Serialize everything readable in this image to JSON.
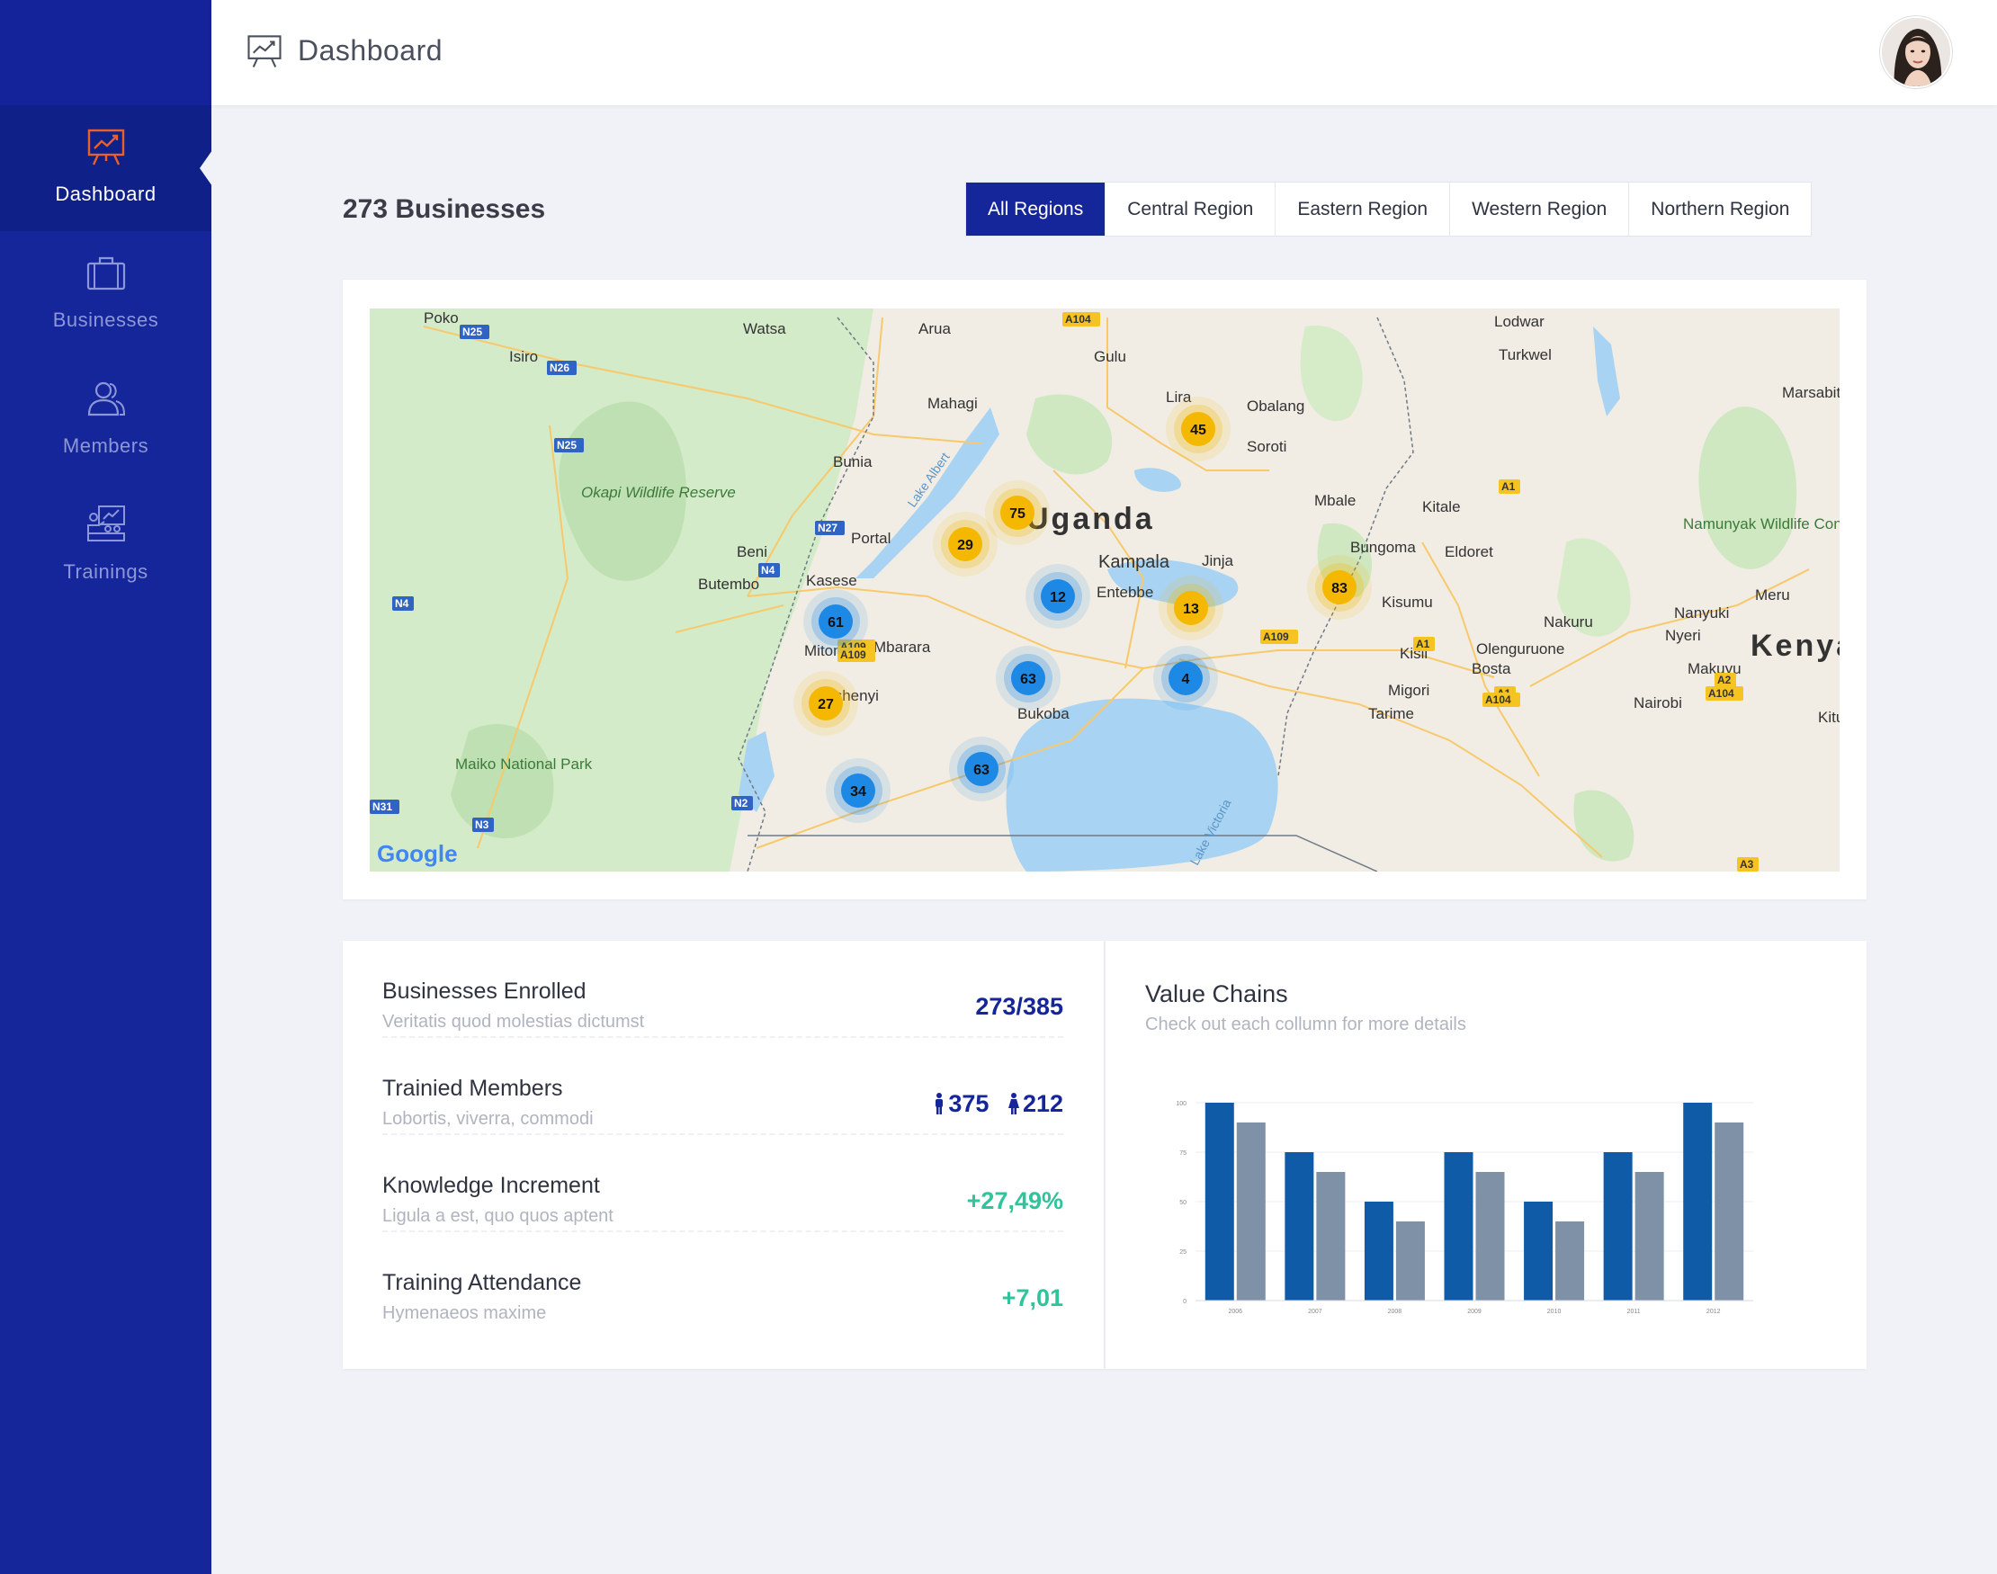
{
  "sidebar": {
    "items": [
      {
        "label": "Dashboard",
        "icon": "presentation-chart-icon",
        "active": true
      },
      {
        "label": "Businesses",
        "icon": "briefcase-icon",
        "active": false
      },
      {
        "label": "Members",
        "icon": "users-icon",
        "active": false
      },
      {
        "label": "Trainings",
        "icon": "training-board-icon",
        "active": false
      }
    ]
  },
  "header": {
    "title": "Dashboard",
    "icon": "presentation-chart-icon",
    "avatar": "user-avatar"
  },
  "businesses": {
    "count_label": "273 Businesses"
  },
  "region_tabs": [
    {
      "label": "All Regions",
      "active": true
    },
    {
      "label": "Central Region",
      "active": false
    },
    {
      "label": "Eastern Region",
      "active": false
    },
    {
      "label": "Western Region",
      "active": false
    },
    {
      "label": "Northern Region",
      "active": false
    }
  ],
  "map": {
    "country_label": "Uganda",
    "kenya_label": "Kenya",
    "provider": "Google",
    "lake_albert_label": "Lake Albert",
    "lake_victoria_label": "Lake Victoria",
    "parks": [
      {
        "id": "okapi",
        "name": "Okapi Wildlife Reserve"
      },
      {
        "id": "maiko",
        "name": "Maiko National Park"
      },
      {
        "id": "namunyak",
        "name": "Namunyak Wildlife Conservation Trust"
      }
    ],
    "cities": [
      {
        "id": "watsa",
        "name": "Watsa"
      },
      {
        "id": "arua",
        "name": "Arua"
      },
      {
        "id": "gulu",
        "name": "Gulu"
      },
      {
        "id": "lodwar",
        "name": "Lodwar"
      },
      {
        "id": "isiro",
        "name": "Isiro"
      },
      {
        "id": "turkwel",
        "name": "Turkwel"
      },
      {
        "id": "mahagi",
        "name": "Mahagi"
      },
      {
        "id": "lira",
        "name": "Lira"
      },
      {
        "id": "obalang",
        "name": "Obalang"
      },
      {
        "id": "marsabit",
        "name": "Marsabit"
      },
      {
        "id": "soroti",
        "name": "Soroti"
      },
      {
        "id": "bunia",
        "name": "Bunia"
      },
      {
        "id": "mbale",
        "name": "Mbale"
      },
      {
        "id": "kitale",
        "name": "Kitale"
      },
      {
        "id": "fortportal",
        "name": "Portal"
      },
      {
        "id": "beni",
        "name": "Beni"
      },
      {
        "id": "jinja",
        "name": "Jinja"
      },
      {
        "id": "bungoma",
        "name": "Bungoma"
      },
      {
        "id": "eldoret",
        "name": "Eldoret"
      },
      {
        "id": "kampala",
        "name": "Kampala"
      },
      {
        "id": "kasese",
        "name": "Kasese"
      },
      {
        "id": "butembo",
        "name": "Butembo"
      },
      {
        "id": "entebbe",
        "name": "Entebbe"
      },
      {
        "id": "kisumu",
        "name": "Kisumu"
      },
      {
        "id": "meru",
        "name": "Meru"
      },
      {
        "id": "nanyuki",
        "name": "Nanyuki"
      },
      {
        "id": "nakuru",
        "name": "Nakuru"
      },
      {
        "id": "nyeri",
        "name": "Nyeri"
      },
      {
        "id": "mitoma",
        "name": "Mitoma"
      },
      {
        "id": "mbarara",
        "name": "Mbarara"
      },
      {
        "id": "kisii",
        "name": "Kisii"
      },
      {
        "id": "olenguruone",
        "name": "Olenguruone"
      },
      {
        "id": "bosta",
        "name": "Bosta"
      },
      {
        "id": "makuyu",
        "name": "Makuyu"
      },
      {
        "id": "rushenyi",
        "name": "Rushenyi"
      },
      {
        "id": "migori",
        "name": "Migori"
      },
      {
        "id": "bukoba",
        "name": "Bukoba"
      },
      {
        "id": "tarime",
        "name": "Tarime"
      },
      {
        "id": "nairobi",
        "name": "Nairobi"
      },
      {
        "id": "kitui",
        "name": "Kitui"
      },
      {
        "id": "poko",
        "name": "Poko"
      }
    ],
    "roads": [
      "N25",
      "N26",
      "N25",
      "N27",
      "N4",
      "N4",
      "A109",
      "A109",
      "A109",
      "N2",
      "N3",
      "N31",
      "A104",
      "A1",
      "A1",
      "A1",
      "A104",
      "A2",
      "A104",
      "A3"
    ],
    "clusters": [
      {
        "id": "lira",
        "value": "45",
        "color": "#f5b800"
      },
      {
        "id": "masindi",
        "value": "75",
        "color": "#f5b800"
      },
      {
        "id": "hoima",
        "value": "29",
        "color": "#f5b800"
      },
      {
        "id": "nakasongola",
        "value": "12",
        "color": "#1e88e5"
      },
      {
        "id": "kamuli",
        "value": "13",
        "color": "#f5b800"
      },
      {
        "id": "mbale",
        "value": "83",
        "color": "#f5b800"
      },
      {
        "id": "fortportal",
        "value": "61",
        "color": "#1e88e5"
      },
      {
        "id": "mubende",
        "value": "63",
        "color": "#1e88e5"
      },
      {
        "id": "mukono",
        "value": "4",
        "color": "#1e88e5"
      },
      {
        "id": "kasese",
        "value": "27",
        "color": "#f5b800"
      },
      {
        "id": "masaka",
        "value": "63",
        "color": "#1e88e5"
      },
      {
        "id": "mitoma",
        "value": "34",
        "color": "#1e88e5"
      }
    ]
  },
  "stats": [
    {
      "title": "Businesses Enrolled",
      "subtitle": "Veritatis quod molestias dictumst",
      "value": "273/385",
      "style": "blue"
    },
    {
      "title": "Trainied Members",
      "subtitle": "Lobortis, viverra, commodi",
      "male": "375",
      "female": "212",
      "style": "blue"
    },
    {
      "title": "Knowledge Increment",
      "subtitle": "Ligula a est, quo quos aptent",
      "value": "+27,49%",
      "style": "green"
    },
    {
      "title": "Training Attendance",
      "subtitle": "Hymenaeos maxime",
      "value": "+7,01",
      "style": "green"
    }
  ],
  "value_chains": {
    "title": "Value Chains",
    "subtitle": "Check out each collumn for more details"
  },
  "chart_data": {
    "type": "bar",
    "categories": [
      "2006",
      "2007",
      "2008",
      "2009",
      "2010",
      "2011",
      "2012"
    ],
    "series": [
      {
        "values": [
          100,
          75,
          50,
          75,
          50,
          75,
          100
        ],
        "color": "#0f5ba8"
      },
      {
        "values": [
          90,
          65,
          40,
          65,
          40,
          65,
          90
        ],
        "color": "#7e91a6"
      }
    ],
    "yticks": [
      "0",
      "25",
      "50",
      "75",
      "100"
    ],
    "ylim": [
      0,
      100
    ],
    "grid": true
  }
}
